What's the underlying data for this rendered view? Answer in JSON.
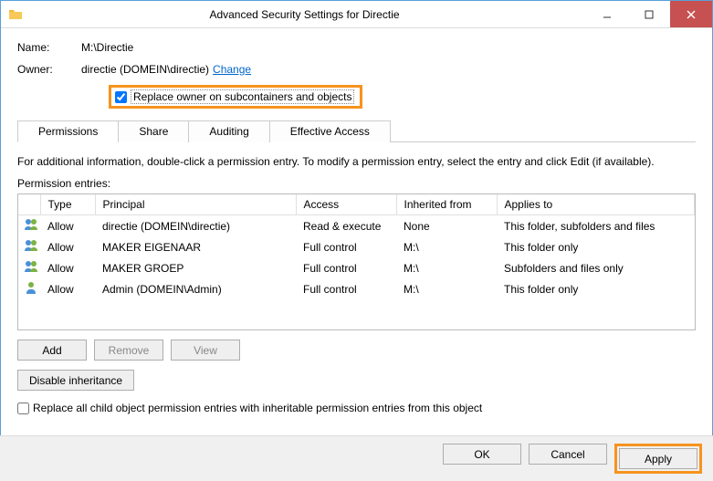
{
  "window": {
    "title": "Advanced Security Settings for Directie"
  },
  "fields": {
    "name_label": "Name:",
    "name_value": "M:\\Directie",
    "owner_label": "Owner:",
    "owner_value": "directie (DOMEIN\\directie)",
    "change_link": "Change",
    "replace_owner": "Replace owner on subcontainers and objects"
  },
  "tabs": {
    "permissions": "Permissions",
    "share": "Share",
    "auditing": "Auditing",
    "effective": "Effective Access"
  },
  "info_text": "For additional information, double-click a permission entry. To modify a permission entry, select the entry and click Edit (if available).",
  "entries_label": "Permission entries:",
  "columns": {
    "type": "Type",
    "principal": "Principal",
    "access": "Access",
    "inherited": "Inherited from",
    "applies": "Applies to"
  },
  "entries": [
    {
      "icon": "group",
      "type": "Allow",
      "principal": "directie (DOMEIN\\directie)",
      "access": "Read & execute",
      "inherited": "None",
      "applies": "This folder, subfolders and files"
    },
    {
      "icon": "group",
      "type": "Allow",
      "principal": "MAKER EIGENAAR",
      "access": "Full control",
      "inherited": "M:\\",
      "applies": "This folder only"
    },
    {
      "icon": "group",
      "type": "Allow",
      "principal": "MAKER GROEP",
      "access": "Full control",
      "inherited": "M:\\",
      "applies": "Subfolders and files only"
    },
    {
      "icon": "person",
      "type": "Allow",
      "principal": "Admin (DOMEIN\\Admin)",
      "access": "Full control",
      "inherited": "M:\\",
      "applies": "This folder only"
    }
  ],
  "buttons": {
    "add": "Add",
    "remove": "Remove",
    "view": "View",
    "disable_inh": "Disable inheritance",
    "replace_all": "Replace all child object permission entries with inheritable permission entries from this object",
    "ok": "OK",
    "cancel": "Cancel",
    "apply": "Apply"
  }
}
